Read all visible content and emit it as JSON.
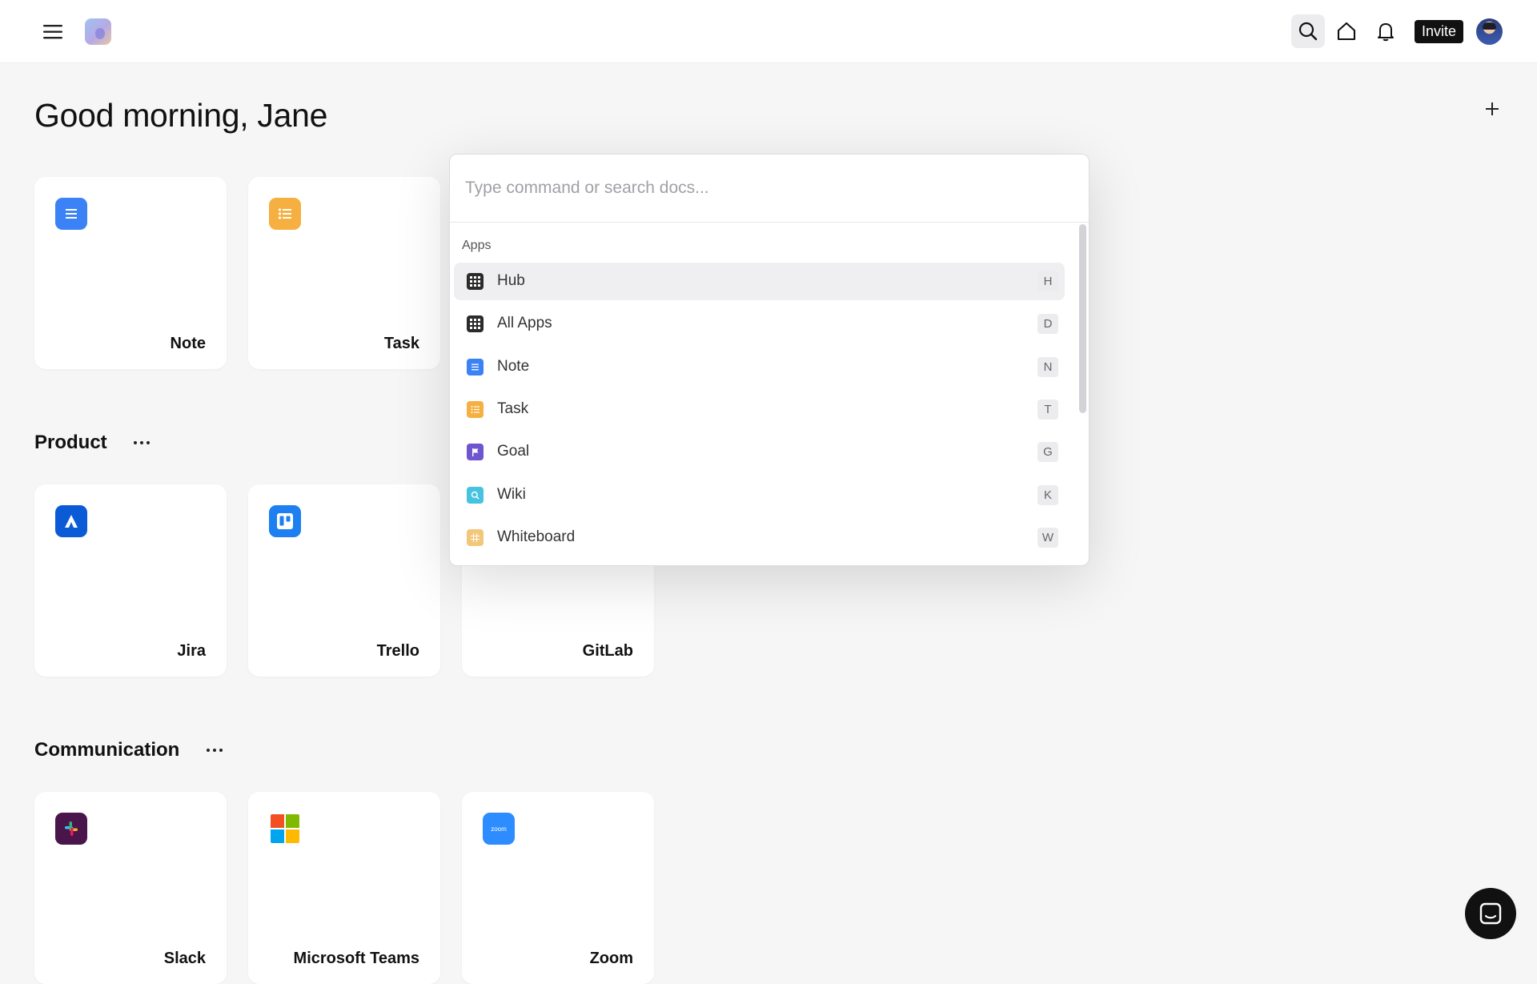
{
  "topbar": {
    "invite_label": "Invite",
    "icons": [
      "menu-icon",
      "logo",
      "search-icon",
      "home-icon",
      "bell-icon",
      "avatar"
    ]
  },
  "main": {
    "greeting": "Good morning, Jane",
    "top_cards": [
      {
        "label": "Note",
        "icon": "note-icon",
        "color": "#3b82f6"
      },
      {
        "label": "Task",
        "icon": "task-icon",
        "color": "#f5b041"
      }
    ],
    "sections": [
      {
        "title": "Product",
        "cards": [
          {
            "label": "Jira",
            "icon": "jira-icon",
            "color": "#0b5ad6"
          },
          {
            "label": "Trello",
            "icon": "trello-icon",
            "color": "#1d7ff0"
          },
          {
            "label": "GitLab",
            "icon": "gitlab-icon",
            "color": "#fc6d26"
          }
        ]
      },
      {
        "title": "Communication",
        "cards": [
          {
            "label": "Slack",
            "icon": "slack-icon",
            "color": "#4a154b"
          },
          {
            "label": "Microsoft Teams",
            "icon": "microsoft-icon",
            "color": "#f25022"
          },
          {
            "label": "Zoom",
            "icon": "zoom-icon",
            "color": "#2d8cff",
            "icon_text": "zoom"
          }
        ]
      }
    ]
  },
  "palette": {
    "placeholder": "Type command or search docs...",
    "group_label": "Apps",
    "items": [
      {
        "label": "Hub",
        "key": "H",
        "icon": "grid-icon",
        "color": "#2b2b2b",
        "active": true
      },
      {
        "label": "All Apps",
        "key": "D",
        "icon": "grid-icon",
        "color": "#2b2b2b"
      },
      {
        "label": "Note",
        "key": "N",
        "icon": "note-icon",
        "color": "#3b82f6"
      },
      {
        "label": "Task",
        "key": "T",
        "icon": "task-icon",
        "color": "#f5b041"
      },
      {
        "label": "Goal",
        "key": "G",
        "icon": "flag-icon",
        "color": "#6e56cf"
      },
      {
        "label": "Wiki",
        "key": "K",
        "icon": "wiki-icon",
        "color": "#46c3e0"
      },
      {
        "label": "Whiteboard",
        "key": "W",
        "icon": "whiteboard-icon",
        "color": "#f3c77a"
      }
    ]
  },
  "colors": {
    "background": "#f6f6f7",
    "accent_dark": "#111111",
    "card_bg": "#ffffff"
  }
}
